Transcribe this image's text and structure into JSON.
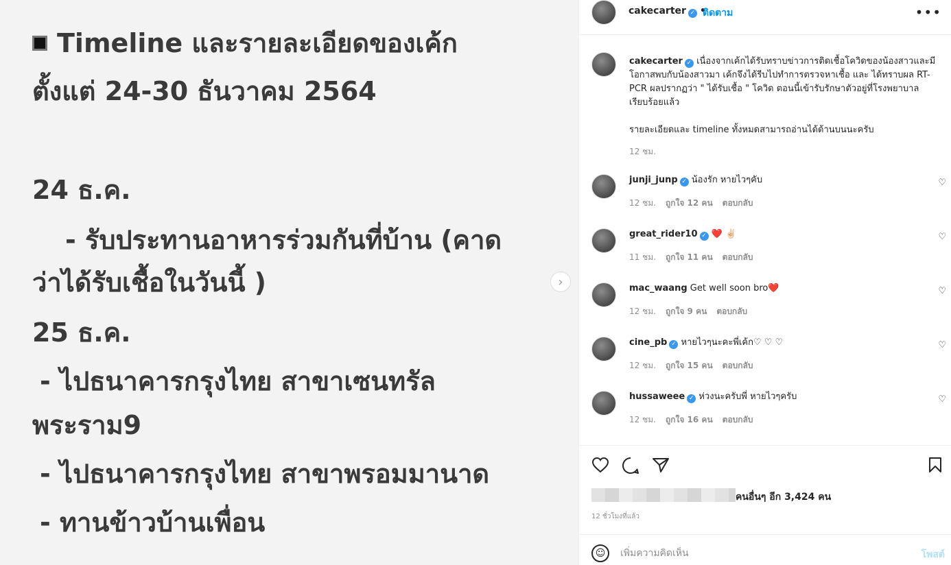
{
  "image_text": {
    "line1": "Timeline และรายละเอียดของเค้ก",
    "line2": "ตั้งแต่ 24-30 ธันวาคม 2564",
    "line3": "24 ธ.ค.",
    "line4": "- รับประทานอาหารร่วมกันที่บ้าน (คาด",
    "line5": "ว่าได้รับเชื้อในวันนี้ )",
    "line6": "25 ธ.ค.",
    "line7": "- ไปธนาคารกรุงไทย สาขาเซนทรัล",
    "line8": "พระราม9",
    "line9": "- ไปธนาคารกรุงไทย สาขาพรอมมานาด",
    "line10": "- ทานข้าวบ้านเพื่อน"
  },
  "header": {
    "username": "cakecarter",
    "dot": "•",
    "follow": "ติดตาม",
    "more": "•••"
  },
  "caption": {
    "username": "cakecarter",
    "text": "เนื่องจากเค้กได้รับทราบข่าวการติดเชื้อโควิดของน้องสาวและมีโอกาสพบกับน้องสาวมา เค้กจึงได้รีบไปทำการตรวจหาเชื้อ และ ได้ทราบผล RT-PCR ผลปรากฏว่า \" ได้รับเชื้อ \" โควิด ตอนนี้เข้ารับรักษาตัวอยู่ที่โรงพยาบาลเรียบร้อยแล้ว",
    "text2": "รายละเอียดและ timeline ทั้งหมดสามารถอ่านได้ด้านบนนะครับ",
    "time": "12 ชม."
  },
  "comments": [
    {
      "username": "junji_junp",
      "text": "น้องรัก หายไวๆคับ",
      "time": "12 ชม.",
      "likes": "ถูกใจ 12 คน",
      "reply": "ตอบกลับ"
    },
    {
      "username": "great_rider10",
      "text": "❤️ ✌🏻",
      "time": "11 ชม.",
      "likes": "ถูกใจ 11 คน",
      "reply": "ตอบกลับ"
    },
    {
      "username": "mac_waang",
      "text": "Get well soon bro❤️",
      "time": "12 ชม.",
      "likes": "ถูกใจ 9 คน",
      "reply": "ตอบกลับ"
    },
    {
      "username": "cine_pb",
      "text": "หายไวๆนะคะพี่เค้ก♡ ♡ ♡",
      "time": "12 ชม.",
      "likes": "ถูกใจ 15 คน",
      "reply": "ตอบกลับ"
    },
    {
      "username": "hussaweee",
      "text": "ห่วงนะครับพี่ หายไวๆครับ",
      "time": "12 ชม.",
      "likes": "ถูกใจ 16 คน",
      "reply": "ตอบกลับ"
    }
  ],
  "likes": {
    "text": "คนอื่นๆ อีก 3,424 คน"
  },
  "post_time": "12 ชั่วโมงที่แล้ว",
  "add_comment": {
    "placeholder": "เพิ่มความคิดเห็น",
    "post": "โพสต์"
  }
}
